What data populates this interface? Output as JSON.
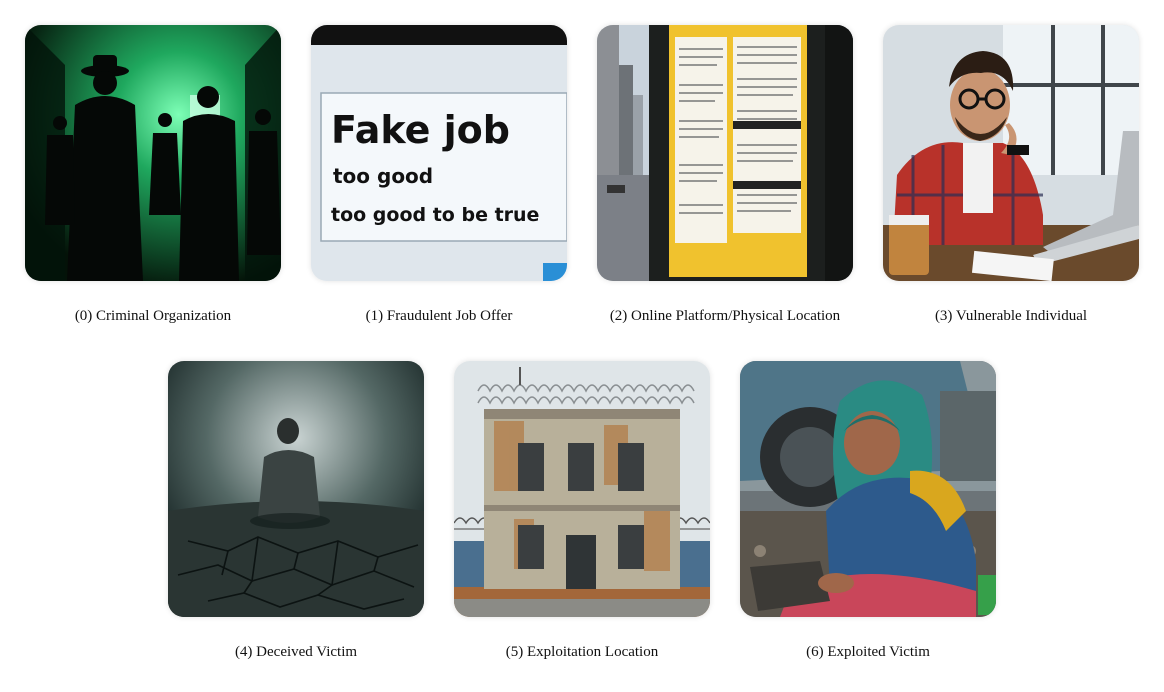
{
  "panels": [
    {
      "caption": "(0) Criminal Organization"
    },
    {
      "caption": "(1) Fraudulent Job Offer",
      "sign_lines": [
        "Fake job",
        "too good",
        "too good to be true"
      ]
    },
    {
      "caption": "(2) Online Platform/Physical Location"
    },
    {
      "caption": "(3) Vulnerable Individual"
    },
    {
      "caption": "(4) Deceived Victim"
    },
    {
      "caption": "(5) Exploitation Location"
    },
    {
      "caption": "(6) Exploited Victim"
    }
  ]
}
